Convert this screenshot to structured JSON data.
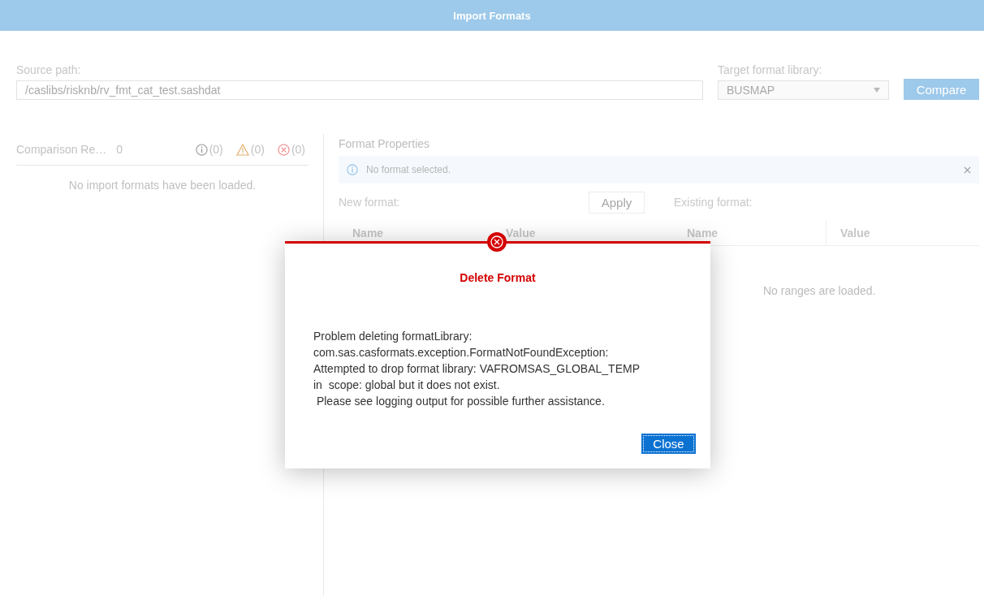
{
  "window": {
    "title": "Import Formats"
  },
  "source": {
    "label": "Source path:",
    "value": "/caslibs/risknb/rv_fmt_cat_test.sashdat"
  },
  "target": {
    "label": "Target format library:",
    "value": "BUSMAP"
  },
  "compare_button": "Compare",
  "comparison": {
    "title": "Comparison Re…",
    "count": "0",
    "badges": [
      {
        "kind": "info",
        "text": "(0)"
      },
      {
        "kind": "warning",
        "text": "(0)"
      },
      {
        "kind": "error",
        "text": "(0)"
      }
    ],
    "empty": "No import formats have been loaded."
  },
  "properties": {
    "title": "Format Properties",
    "notice": "No format selected.",
    "new_label": "New format:",
    "apply_button": "Apply",
    "existing_label": "Existing format:",
    "new_columns": [
      "Name",
      "Value"
    ],
    "existing_columns": [
      "Name",
      "Value"
    ],
    "empty": "No ranges are loaded."
  },
  "dialog": {
    "title": "Delete Format",
    "message": "Problem deleting formatLibrary:\ncom.sas.casformats.exception.FormatNotFoundException:\nAttempted to drop format library: VAFROMSAS_GLOBAL_TEMP\nin  scope: global but it does not exist.\n Please see logging output for possible further assistance.",
    "button": "Close"
  }
}
